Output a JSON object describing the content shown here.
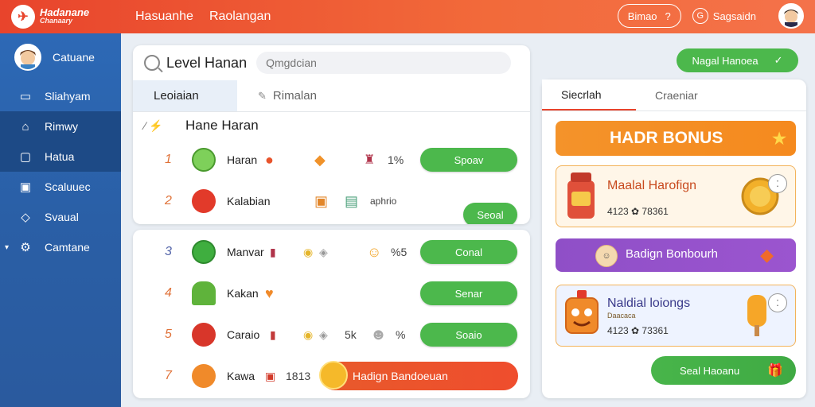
{
  "brand": {
    "name": "Hadanane",
    "tagline": "Chanaary"
  },
  "topnav": [
    "Hasuanhe",
    "Raolangan"
  ],
  "topbar": {
    "pill_label": "Bimao",
    "pill_icon": "?",
    "user_label": "Sagsaidn",
    "user_icon": "G"
  },
  "sidebar": {
    "items": [
      {
        "label": "Catuane",
        "icon": "avatar"
      },
      {
        "label": "Sliahyam",
        "icon": "chat-icon"
      },
      {
        "label": "Rimwy",
        "icon": "house-icon"
      },
      {
        "label": "Hatua",
        "icon": "monitor-icon"
      },
      {
        "label": "Scaluuec",
        "icon": "calendar-icon"
      },
      {
        "label": "Svaual",
        "icon": "tag-icon"
      },
      {
        "label": "Camtane",
        "icon": "gear-icon"
      }
    ]
  },
  "search": {
    "title": "Level Hanan",
    "placeholder": "Qmgdcian"
  },
  "left_tabs": [
    "Leoiaian",
    "Rimalan"
  ],
  "list": {
    "heading": "Hane Haran",
    "rows": [
      {
        "num": "1",
        "name": "Haran",
        "extra": "1%",
        "button": "Spoav"
      },
      {
        "num": "2",
        "name": "Kalabian",
        "extra": "aphrio",
        "button": "Seoal"
      },
      {
        "num": "3",
        "name": "Manvar",
        "extra": "%5",
        "button": "Conal"
      },
      {
        "num": "4",
        "name": "Kakan",
        "extra": "",
        "button": "Senar"
      },
      {
        "num": "5",
        "name": "Caraio",
        "extra": "5k",
        "extra2": "%",
        "button": "Soaio"
      },
      {
        "num": "7",
        "name": "Kawa",
        "extra": "1813",
        "button": "Hadign Bandoeuan"
      }
    ]
  },
  "top_right_button": {
    "label": "Nagal Hanoea",
    "icon": "✓"
  },
  "right_tabs": [
    "Siecrlah",
    "Craeniar"
  ],
  "bonus": {
    "title": "HADR BONUS",
    "icon": "★"
  },
  "cards": [
    {
      "title": "Maalal Harofign",
      "sub": "4123 ✿ 78361",
      "chip": "⁚"
    },
    {
      "title": "Badign Bonbourh",
      "sub": "",
      "chip": ""
    },
    {
      "title": "Naldial loiongs",
      "sub": "4123 ✿ 73361",
      "small": "Daacaca",
      "chip": "⁚"
    }
  ],
  "send_button": {
    "label": "Seal Haoanu",
    "icon": "🎁"
  },
  "colors": {
    "primary": "#e8442c",
    "sidebar": "#2a5fa6",
    "green": "#4cb84c",
    "bonus": "#f4932a",
    "purple": "#9b55cf"
  }
}
